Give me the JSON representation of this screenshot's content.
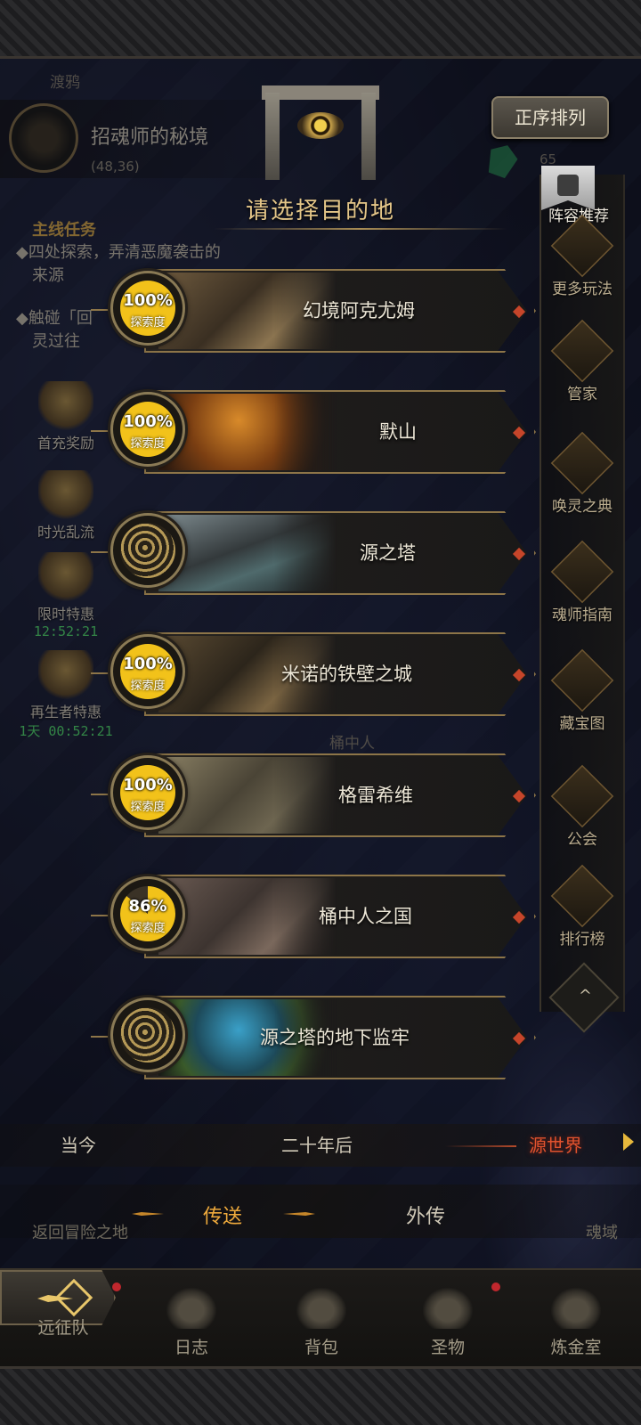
{
  "hud": {
    "top_label": "渡鸦",
    "map_name": "招魂师的秘境",
    "map_coords": "(48,36)",
    "quest_title": "主线任务",
    "quest_lines": [
      "◆四处探索，弄清恶魔袭击的",
      "来源",
      "◆触碰「回",
      "灵过往"
    ],
    "left_buttons": [
      {
        "label": "首充奖励",
        "timer": ""
      },
      {
        "label": "时光乱流",
        "timer": ""
      },
      {
        "label": "限时特惠",
        "timer": "12:52:21"
      },
      {
        "label": "再生者特惠",
        "timer": "1天 00:52:21"
      }
    ],
    "npc_label": "桶中人",
    "number_65": "65"
  },
  "header": {
    "title": "请选择目的地",
    "sort_button": "正序排列"
  },
  "right_menu": {
    "recommend": "阵容推荐",
    "items": [
      {
        "label": "更多玩法",
        "icon": "more-play-icon"
      },
      {
        "label": "管家",
        "icon": "butler-icon"
      },
      {
        "label": "唤灵之典",
        "icon": "codex-icon"
      },
      {
        "label": "魂师指南",
        "icon": "guide-icon"
      },
      {
        "label": "藏宝图",
        "icon": "treasure-map-icon"
      },
      {
        "label": "公会",
        "icon": "guild-icon"
      },
      {
        "label": "排行榜",
        "icon": "leaderboard-icon"
      }
    ],
    "collapse": "^"
  },
  "destinations": [
    {
      "name": "幻境阿克尤姆",
      "progress_text": "100%",
      "progress": 1.0,
      "progress_label": "探索度",
      "locked": false
    },
    {
      "name": "默山",
      "progress_text": "100%",
      "progress": 1.0,
      "progress_label": "探索度",
      "locked": false
    },
    {
      "name": "源之塔",
      "progress_text": "",
      "progress": null,
      "progress_label": "",
      "locked": true
    },
    {
      "name": "米诺的铁壁之城",
      "progress_text": "100%",
      "progress": 1.0,
      "progress_label": "探索度",
      "locked": false
    },
    {
      "name": "格雷希维",
      "progress_text": "100%",
      "progress": 1.0,
      "progress_label": "探索度",
      "locked": false
    },
    {
      "name": "桶中人之国",
      "progress_text": "86%",
      "progress": 0.86,
      "progress_label": "探索度",
      "locked": false
    },
    {
      "name": "源之塔的地下监牢",
      "progress_text": "",
      "progress": null,
      "progress_label": "",
      "locked": true
    }
  ],
  "eras": {
    "items": [
      "当今",
      "二十年后",
      "源世界"
    ],
    "active": "源世界"
  },
  "modes": {
    "items": [
      "传送",
      "外传"
    ],
    "active": "传送",
    "bg_left": "返回冒险之地",
    "bg_right": "魂域"
  },
  "bottom_nav": {
    "items": [
      {
        "label": "远征队",
        "icon": "expedition-icon"
      },
      {
        "label": "日志",
        "icon": "journal-icon"
      },
      {
        "label": "背包",
        "icon": "backpack-icon"
      },
      {
        "label": "圣物",
        "icon": "relic-icon"
      },
      {
        "label": "炼金室",
        "icon": "alchemy-icon"
      }
    ]
  },
  "colors": {
    "accent_gold": "#e4c688",
    "active_era": "#e0522e",
    "active_mode": "#efaa3c",
    "progress_yellow": "#f2c21a",
    "timer_green": "#4fd36a"
  }
}
